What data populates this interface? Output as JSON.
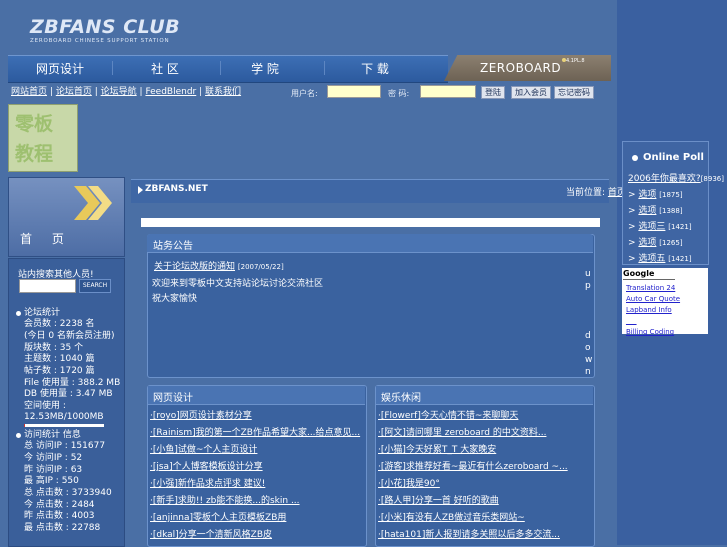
{
  "header": {
    "logo": "ZBFANS CLUB",
    "logo_sub": "ZEROBOARD CHINESE SUPPORT STATION",
    "nav": [
      "网页设计",
      "社 区",
      "学 院",
      "下 载"
    ],
    "zb_tab": "ZEROBOARD",
    "zb_sup": "4.1PL.8"
  },
  "toplinks": {
    "items": [
      "网站首页",
      "论坛首页",
      "论坛导航",
      "FeedBlendr",
      "联系我们"
    ],
    "sep": "|"
  },
  "login": {
    "username_label": "用户名:",
    "password_label": "密 码:",
    "login_btn": "登陆",
    "join_btn": "加入会员",
    "forgot_btn": "忘记密码"
  },
  "banner": {
    "line1": "零板",
    "line2": "教程"
  },
  "home": {
    "label": "首 页"
  },
  "search": {
    "label": "站内搜索其他人员!",
    "button": "SEARCH"
  },
  "stats": {
    "title": "论坛统计",
    "lines": [
      "会员数 : 2238 名",
      "(今日 0 名新会员注册)",
      "版块数 : 35 个",
      "主题数 : 1040 篇",
      "帖子数 : 1720 篇",
      "File 使用量 : 388.2 MB",
      "DB 使用量 : 3.47 MB",
      "空间使用 :",
      "12.53MB/1000MB"
    ],
    "space_fraction": 0.0125
  },
  "visits": {
    "title": "访问统计 信息",
    "lines": [
      "总 访问IP : 151677",
      "今 访问IP : 52",
      "昨 访问IP : 63",
      "最 高IP : 550",
      "总 点击数 : 3733940",
      "今 点击数 : 2484",
      "昨 点击数 : 4003",
      "最 点击数 : 22788"
    ]
  },
  "main": {
    "site": "ZBFANS.NET",
    "right_label": "当前位置: ",
    "right_link": "首页"
  },
  "notice": {
    "title": "站务公告",
    "item_link": "关于论坛改版的通知",
    "item_date": "[2007/05/22]",
    "text1": "欢迎来到零板中文支持站论坛讨论交流社区",
    "text2": "祝大家愉快",
    "up": "u p",
    "down": "d o w n"
  },
  "web_design": {
    "title": "网页设计",
    "rows": [
      "·[royo]网页设计素材分享",
      "·[Rainism]我的第一个ZB作品希望大家...给点意见...",
      "·[小鱼]试做~个人主页设计",
      "·[jsa]个人博客模板设计分享",
      "·[小强]新作品求点评求 建议!",
      "·[新手]求助!! zb能不能换...的skin ...",
      "·[anjinna]零板个人主页模板ZB用",
      "·[dkal]分享一个清新风格ZB皮"
    ]
  },
  "entertain": {
    "title": "娱乐休闲",
    "rows": [
      "·[Flowerf]今天心情不错~来聊聊天",
      "·[阿文]请问哪里 zeroboard 的中文资料...",
      "·[小猫]今天好累T_T 大家晚安",
      "·[游客]求推荐好看~最近有什么zeroboard ~...",
      "·[小花]我是90°",
      "·[路人甲]分享一首 好听的歌曲",
      "·[小米]有没有人ZB做过音乐类网站~",
      "·[hata101]新人报到请多关照以后多多交流..."
    ]
  },
  "poll": {
    "title": "Online Poll",
    "question": "2006年你最喜欢?",
    "question_count": "[8936]",
    "options": [
      {
        "label": "选项",
        "count": "[1875]"
      },
      {
        "label": "选项",
        "count": "[1388]"
      },
      {
        "label": "选项三",
        "count": "[1421]"
      },
      {
        "label": "选项",
        "count": "[1265]"
      },
      {
        "label": "选项五",
        "count": "[1421]"
      }
    ]
  },
  "ads": {
    "brand": "Google",
    "links": [
      "Translation 24",
      "Auto Car Quote",
      "Lapband Info",
      "___",
      "Billing Coding"
    ]
  },
  "colors": {
    "background": "#4a6fa5",
    "highlight": "#ffffcc",
    "zb_tab": "#7f7362"
  }
}
